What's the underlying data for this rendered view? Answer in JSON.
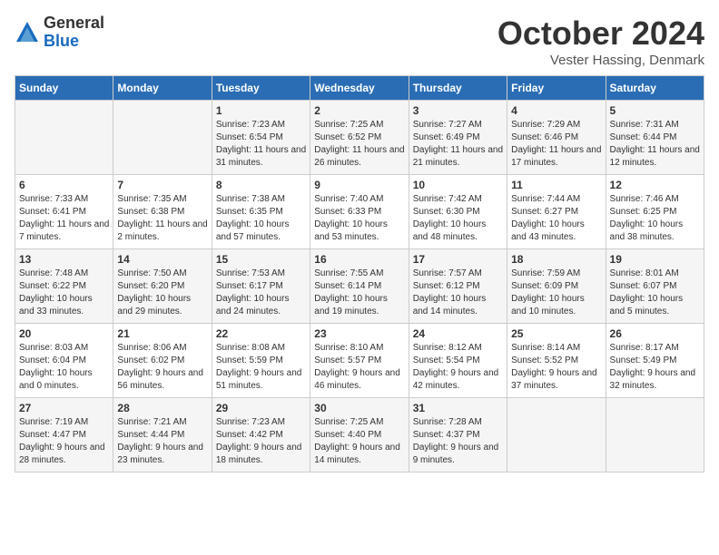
{
  "logo": {
    "general": "General",
    "blue": "Blue"
  },
  "title": "October 2024",
  "subtitle": "Vester Hassing, Denmark",
  "weekdays": [
    "Sunday",
    "Monday",
    "Tuesday",
    "Wednesday",
    "Thursday",
    "Friday",
    "Saturday"
  ],
  "weeks": [
    [
      {
        "day": "",
        "sunrise": "",
        "sunset": "",
        "daylight": ""
      },
      {
        "day": "",
        "sunrise": "",
        "sunset": "",
        "daylight": ""
      },
      {
        "day": "1",
        "sunrise": "Sunrise: 7:23 AM",
        "sunset": "Sunset: 6:54 PM",
        "daylight": "Daylight: 11 hours and 31 minutes."
      },
      {
        "day": "2",
        "sunrise": "Sunrise: 7:25 AM",
        "sunset": "Sunset: 6:52 PM",
        "daylight": "Daylight: 11 hours and 26 minutes."
      },
      {
        "day": "3",
        "sunrise": "Sunrise: 7:27 AM",
        "sunset": "Sunset: 6:49 PM",
        "daylight": "Daylight: 11 hours and 21 minutes."
      },
      {
        "day": "4",
        "sunrise": "Sunrise: 7:29 AM",
        "sunset": "Sunset: 6:46 PM",
        "daylight": "Daylight: 11 hours and 17 minutes."
      },
      {
        "day": "5",
        "sunrise": "Sunrise: 7:31 AM",
        "sunset": "Sunset: 6:44 PM",
        "daylight": "Daylight: 11 hours and 12 minutes."
      }
    ],
    [
      {
        "day": "6",
        "sunrise": "Sunrise: 7:33 AM",
        "sunset": "Sunset: 6:41 PM",
        "daylight": "Daylight: 11 hours and 7 minutes."
      },
      {
        "day": "7",
        "sunrise": "Sunrise: 7:35 AM",
        "sunset": "Sunset: 6:38 PM",
        "daylight": "Daylight: 11 hours and 2 minutes."
      },
      {
        "day": "8",
        "sunrise": "Sunrise: 7:38 AM",
        "sunset": "Sunset: 6:35 PM",
        "daylight": "Daylight: 10 hours and 57 minutes."
      },
      {
        "day": "9",
        "sunrise": "Sunrise: 7:40 AM",
        "sunset": "Sunset: 6:33 PM",
        "daylight": "Daylight: 10 hours and 53 minutes."
      },
      {
        "day": "10",
        "sunrise": "Sunrise: 7:42 AM",
        "sunset": "Sunset: 6:30 PM",
        "daylight": "Daylight: 10 hours and 48 minutes."
      },
      {
        "day": "11",
        "sunrise": "Sunrise: 7:44 AM",
        "sunset": "Sunset: 6:27 PM",
        "daylight": "Daylight: 10 hours and 43 minutes."
      },
      {
        "day": "12",
        "sunrise": "Sunrise: 7:46 AM",
        "sunset": "Sunset: 6:25 PM",
        "daylight": "Daylight: 10 hours and 38 minutes."
      }
    ],
    [
      {
        "day": "13",
        "sunrise": "Sunrise: 7:48 AM",
        "sunset": "Sunset: 6:22 PM",
        "daylight": "Daylight: 10 hours and 33 minutes."
      },
      {
        "day": "14",
        "sunrise": "Sunrise: 7:50 AM",
        "sunset": "Sunset: 6:20 PM",
        "daylight": "Daylight: 10 hours and 29 minutes."
      },
      {
        "day": "15",
        "sunrise": "Sunrise: 7:53 AM",
        "sunset": "Sunset: 6:17 PM",
        "daylight": "Daylight: 10 hours and 24 minutes."
      },
      {
        "day": "16",
        "sunrise": "Sunrise: 7:55 AM",
        "sunset": "Sunset: 6:14 PM",
        "daylight": "Daylight: 10 hours and 19 minutes."
      },
      {
        "day": "17",
        "sunrise": "Sunrise: 7:57 AM",
        "sunset": "Sunset: 6:12 PM",
        "daylight": "Daylight: 10 hours and 14 minutes."
      },
      {
        "day": "18",
        "sunrise": "Sunrise: 7:59 AM",
        "sunset": "Sunset: 6:09 PM",
        "daylight": "Daylight: 10 hours and 10 minutes."
      },
      {
        "day": "19",
        "sunrise": "Sunrise: 8:01 AM",
        "sunset": "Sunset: 6:07 PM",
        "daylight": "Daylight: 10 hours and 5 minutes."
      }
    ],
    [
      {
        "day": "20",
        "sunrise": "Sunrise: 8:03 AM",
        "sunset": "Sunset: 6:04 PM",
        "daylight": "Daylight: 10 hours and 0 minutes."
      },
      {
        "day": "21",
        "sunrise": "Sunrise: 8:06 AM",
        "sunset": "Sunset: 6:02 PM",
        "daylight": "Daylight: 9 hours and 56 minutes."
      },
      {
        "day": "22",
        "sunrise": "Sunrise: 8:08 AM",
        "sunset": "Sunset: 5:59 PM",
        "daylight": "Daylight: 9 hours and 51 minutes."
      },
      {
        "day": "23",
        "sunrise": "Sunrise: 8:10 AM",
        "sunset": "Sunset: 5:57 PM",
        "daylight": "Daylight: 9 hours and 46 minutes."
      },
      {
        "day": "24",
        "sunrise": "Sunrise: 8:12 AM",
        "sunset": "Sunset: 5:54 PM",
        "daylight": "Daylight: 9 hours and 42 minutes."
      },
      {
        "day": "25",
        "sunrise": "Sunrise: 8:14 AM",
        "sunset": "Sunset: 5:52 PM",
        "daylight": "Daylight: 9 hours and 37 minutes."
      },
      {
        "day": "26",
        "sunrise": "Sunrise: 8:17 AM",
        "sunset": "Sunset: 5:49 PM",
        "daylight": "Daylight: 9 hours and 32 minutes."
      }
    ],
    [
      {
        "day": "27",
        "sunrise": "Sunrise: 7:19 AM",
        "sunset": "Sunset: 4:47 PM",
        "daylight": "Daylight: 9 hours and 28 minutes."
      },
      {
        "day": "28",
        "sunrise": "Sunrise: 7:21 AM",
        "sunset": "Sunset: 4:44 PM",
        "daylight": "Daylight: 9 hours and 23 minutes."
      },
      {
        "day": "29",
        "sunrise": "Sunrise: 7:23 AM",
        "sunset": "Sunset: 4:42 PM",
        "daylight": "Daylight: 9 hours and 18 minutes."
      },
      {
        "day": "30",
        "sunrise": "Sunrise: 7:25 AM",
        "sunset": "Sunset: 4:40 PM",
        "daylight": "Daylight: 9 hours and 14 minutes."
      },
      {
        "day": "31",
        "sunrise": "Sunrise: 7:28 AM",
        "sunset": "Sunset: 4:37 PM",
        "daylight": "Daylight: 9 hours and 9 minutes."
      },
      {
        "day": "",
        "sunrise": "",
        "sunset": "",
        "daylight": ""
      },
      {
        "day": "",
        "sunrise": "",
        "sunset": "",
        "daylight": ""
      }
    ]
  ]
}
